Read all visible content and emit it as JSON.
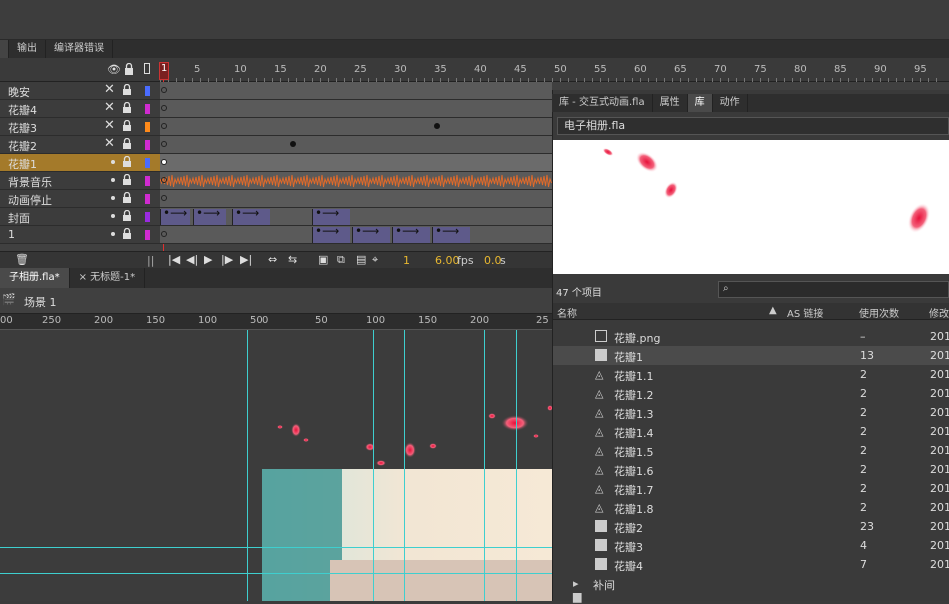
{
  "panel_tabs": [
    "输出",
    "编译器错误"
  ],
  "timeline": {
    "frame_numbers": [
      "1",
      "5",
      "10",
      "15",
      "20",
      "25",
      "30",
      "35",
      "40",
      "45",
      "50",
      "55",
      "60",
      "65",
      "70",
      "75",
      "80",
      "85",
      "90",
      "95"
    ],
    "current_frame": "1",
    "fps": "6.00",
    "fps_unit": "fps",
    "time": "0.0",
    "time_unit": "s",
    "layers": [
      {
        "name": "晚安",
        "hidden": true,
        "color": "#4a6cff"
      },
      {
        "name": "花瓣4",
        "hidden": true,
        "color": "#d02bd0"
      },
      {
        "name": "花瓣3",
        "hidden": true,
        "color": "#ff8a1a"
      },
      {
        "name": "花瓣2",
        "hidden": true,
        "color": "#d02bd0"
      },
      {
        "name": "花瓣1",
        "hidden": false,
        "color": "#4a6cff",
        "selected": true
      },
      {
        "name": "背景音乐",
        "hidden": false,
        "color": "#d02bd0"
      },
      {
        "name": "动画停止",
        "hidden": false,
        "color": "#d02bd0"
      },
      {
        "name": "封面",
        "hidden": false,
        "color": "#9a2be0"
      },
      {
        "name": "1",
        "hidden": false,
        "color": "#d02bd0"
      }
    ]
  },
  "library": {
    "tabs": [
      "库 - 交互式动画.fla",
      "属性",
      "库",
      "动作"
    ],
    "active_tab": 2,
    "document": "电子相册.fla",
    "item_count": "47 个项目",
    "columns": {
      "name": "名称",
      "linkage": "AS 链接",
      "use_count": "使用次数",
      "modified": "修改"
    },
    "items": [
      {
        "name": "花瓣.png",
        "type": "bitmap",
        "count": "–",
        "date": "201"
      },
      {
        "name": "花瓣1",
        "type": "movieclip",
        "count": "13",
        "date": "201",
        "selected": true
      },
      {
        "name": "花瓣1.1",
        "type": "graphic",
        "count": "2",
        "date": "201"
      },
      {
        "name": "花瓣1.2",
        "type": "graphic",
        "count": "2",
        "date": "201"
      },
      {
        "name": "花瓣1.3",
        "type": "graphic",
        "count": "2",
        "date": "201"
      },
      {
        "name": "花瓣1.4",
        "type": "graphic",
        "count": "2",
        "date": "201"
      },
      {
        "name": "花瓣1.5",
        "type": "graphic",
        "count": "2",
        "date": "201"
      },
      {
        "name": "花瓣1.6",
        "type": "graphic",
        "count": "2",
        "date": "201"
      },
      {
        "name": "花瓣1.7",
        "type": "graphic",
        "count": "2",
        "date": "201"
      },
      {
        "name": "花瓣1.8",
        "type": "graphic",
        "count": "2",
        "date": "201"
      },
      {
        "name": "花瓣2",
        "type": "movieclip",
        "count": "23",
        "date": "201"
      },
      {
        "name": "花瓣3",
        "type": "movieclip",
        "count": "4",
        "date": "201"
      },
      {
        "name": "花瓣4",
        "type": "movieclip",
        "count": "7",
        "date": "201"
      },
      {
        "name": "补间",
        "type": "folder",
        "count": "",
        "date": ""
      }
    ]
  },
  "documents": {
    "tabs": [
      "子相册.fla*",
      "无标题-1*"
    ],
    "scene": "场景 1"
  },
  "ruler_numbers": [
    "00",
    "250",
    "200",
    "150",
    "100",
    "50",
    "0",
    "50",
    "100",
    "150",
    "200",
    "25"
  ]
}
